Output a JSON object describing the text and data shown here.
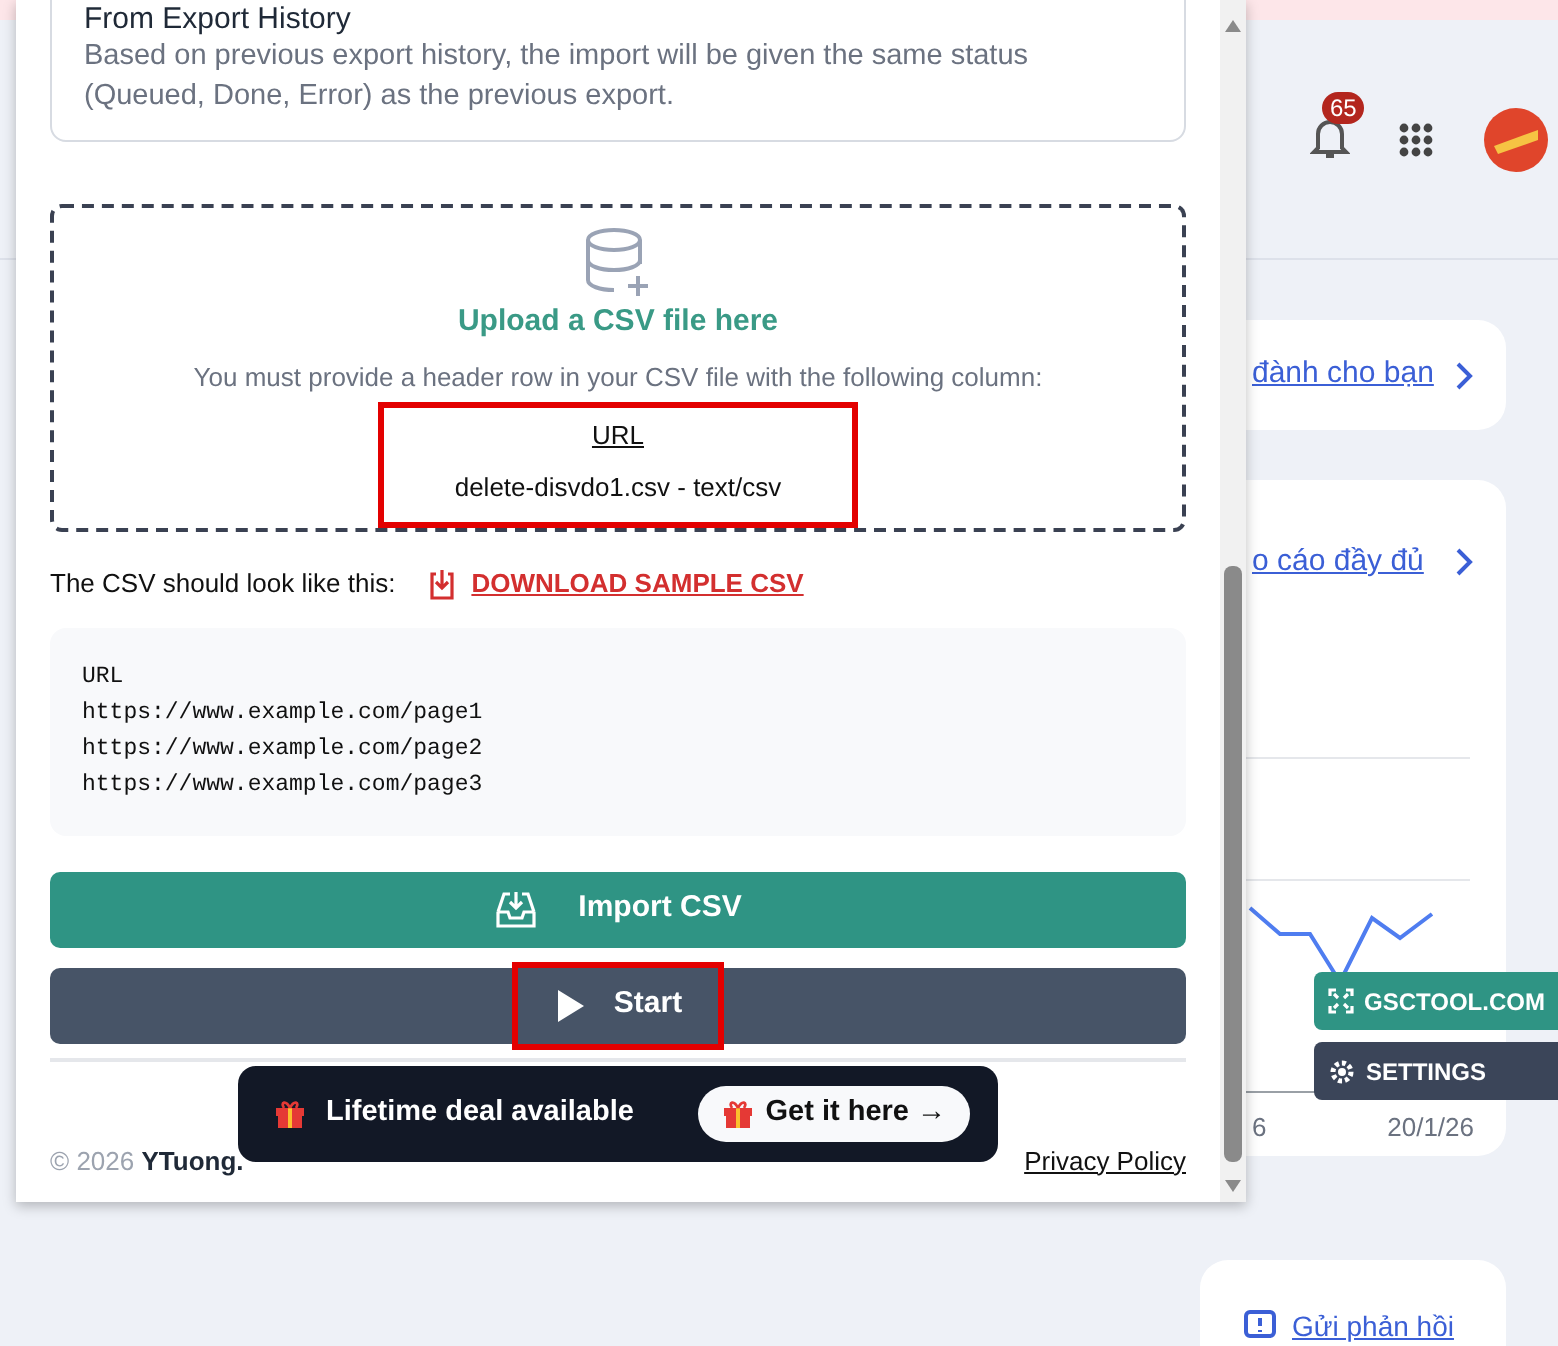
{
  "page": {
    "notification_count": "65",
    "cards": [
      {
        "link": "đành cho bạn"
      },
      {
        "link": "o cáo đầy đủ"
      }
    ],
    "chart_labels": [
      "6",
      "20/1/26"
    ],
    "feedback_link": "Gửi phản hồi"
  },
  "side_buttons": [
    {
      "label": "GSCTOOL.COM",
      "kind": "site"
    },
    {
      "label": "SETTINGS",
      "kind": "settings"
    }
  ],
  "dialog": {
    "option": {
      "title": "From Export History",
      "description": "Based on previous export history, the import will be given the same status (Queued, Done, Error) as the previous export."
    },
    "upload": {
      "title": "Upload a CSV file here",
      "hint": "You must provide a header row in your CSV file with the following column:",
      "column": "URL",
      "file": "delete-disvdo1.csv - text/csv",
      "highlighted": true
    },
    "sample_label": "The CSV should look like this:",
    "download_link": "DOWNLOAD SAMPLE CSV",
    "sample_lines": [
      "URL",
      "https://www.example.com/page1",
      "https://www.example.com/page2",
      "https://www.example.com/page3"
    ],
    "buttons": [
      {
        "label": "Import CSV",
        "kind": "import",
        "highlighted": false
      },
      {
        "label": "Start",
        "kind": "start",
        "highlighted": true
      }
    ],
    "footer": {
      "copyright": "© 2026 **YTuong.**",
      "privacy_link": "Privacy Policy"
    }
  },
  "promo": {
    "text": "Lifetime deal available",
    "button": "Get it here →"
  }
}
